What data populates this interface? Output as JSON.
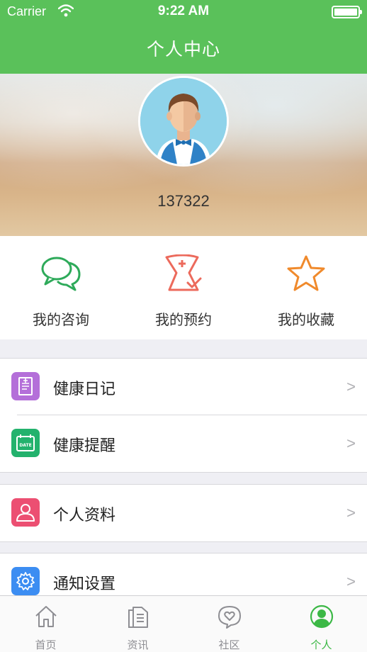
{
  "status_bar": {
    "carrier": "Carrier",
    "time": "9:22 AM"
  },
  "nav": {
    "title": "个人中心"
  },
  "profile": {
    "username": "137322"
  },
  "quick_actions": [
    {
      "label": "我的咨询",
      "icon": "chat-bubbles-icon",
      "color": "#2eaa5a"
    },
    {
      "label": "我的预约",
      "icon": "nurse-cap-check-icon",
      "color": "#ec6a5c"
    },
    {
      "label": "我的收藏",
      "icon": "star-icon",
      "color": "#f08a2c"
    }
  ],
  "menu": [
    {
      "label": "健康日记",
      "icon": "diary-icon",
      "color": "#b46fd9",
      "chevron": ">"
    },
    {
      "label": "健康提醒",
      "icon": "calendar-date-icon",
      "color": "#23b26d",
      "chevron": ">"
    },
    {
      "label": "个人资料",
      "icon": "person-icon",
      "color": "#ec4f72",
      "chevron": ">"
    },
    {
      "label": "通知设置",
      "icon": "gear-icon",
      "color": "#3c8df2",
      "chevron": ">"
    }
  ],
  "tabs": [
    {
      "label": "首页",
      "icon": "home-icon",
      "active": false
    },
    {
      "label": "资讯",
      "icon": "news-icon",
      "active": false
    },
    {
      "label": "社区",
      "icon": "community-heart-icon",
      "active": false
    },
    {
      "label": "个人",
      "icon": "profile-icon",
      "active": true
    }
  ],
  "colors": {
    "brand": "#5ac15a",
    "active_tab": "#3cb846",
    "inactive_tab": "#8e8e93"
  }
}
